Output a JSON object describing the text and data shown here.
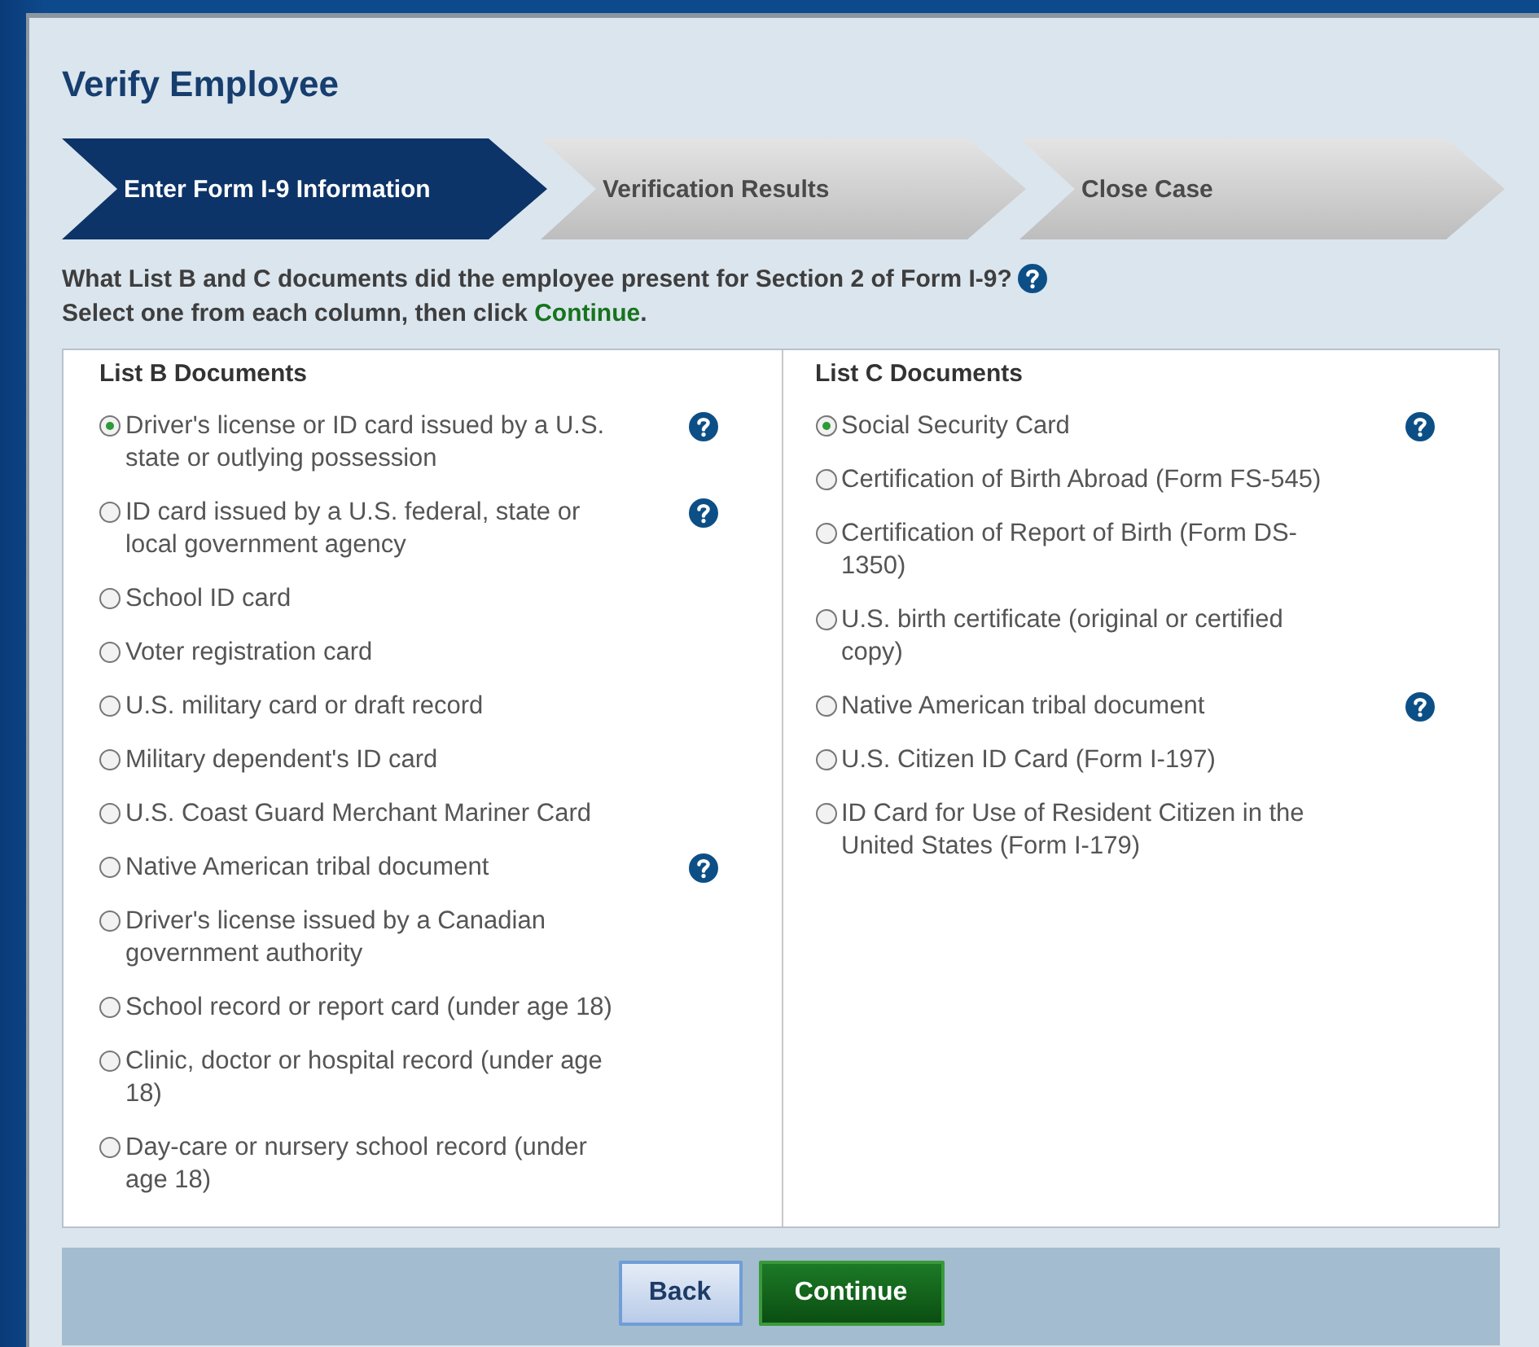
{
  "title": "Verify Employee",
  "steps": [
    {
      "label": "Enter Form I-9 Information",
      "selected": true
    },
    {
      "label": "Verification Results",
      "selected": false
    },
    {
      "label": "Close Case",
      "selected": false
    }
  ],
  "question": {
    "text": "What List B and C documents did the employee present for Section 2 of Form I-9?",
    "help": true
  },
  "instruction": {
    "before": "Select one from each column, then click ",
    "link": "Continue",
    "after": "."
  },
  "lists": [
    {
      "heading": "List B Documents",
      "items": [
        {
          "label": "Driver's license or ID card issued by a U.S. state or outlying possession",
          "selected": true,
          "help": true
        },
        {
          "label": "ID card issued by a U.S. federal, state or local government agency",
          "selected": false,
          "help": true
        },
        {
          "label": "School ID card",
          "selected": false,
          "help": false
        },
        {
          "label": "Voter registration card",
          "selected": false,
          "help": false
        },
        {
          "label": "U.S. military card or draft record",
          "selected": false,
          "help": false
        },
        {
          "label": "Military dependent's ID card",
          "selected": false,
          "help": false
        },
        {
          "label": "U.S. Coast Guard Merchant Mariner Card",
          "selected": false,
          "help": false
        },
        {
          "label": "Native American tribal document",
          "selected": false,
          "help": true
        },
        {
          "label": "Driver's license issued by a Canadian government authority",
          "selected": false,
          "help": false
        },
        {
          "label": "School record or report card (under age 18)",
          "selected": false,
          "help": false
        },
        {
          "label": "Clinic, doctor or hospital record (under age 18)",
          "selected": false,
          "help": false
        },
        {
          "label": "Day-care or nursery school record (under age 18)",
          "selected": false,
          "help": false
        }
      ]
    },
    {
      "heading": "List C Documents",
      "items": [
        {
          "label": "Social Security Card",
          "selected": true,
          "help": true
        },
        {
          "label": "Certification of Birth Abroad (Form FS-545)",
          "selected": false,
          "help": false
        },
        {
          "label": "Certification of Report of Birth (Form DS-1350)",
          "selected": false,
          "help": false
        },
        {
          "label": "U.S. birth certificate (original or certified copy)",
          "selected": false,
          "help": false
        },
        {
          "label": "Native American tribal document",
          "selected": false,
          "help": true
        },
        {
          "label": "U.S. Citizen ID Card (Form I-197)",
          "selected": false,
          "help": false
        },
        {
          "label": "ID Card for Use of Resident Citizen in the United States (Form I-179)",
          "selected": false,
          "help": false
        }
      ]
    }
  ],
  "buttons": [
    {
      "label": "Back",
      "kind": "secondary"
    },
    {
      "label": "Continue",
      "kind": "primary"
    }
  ]
}
